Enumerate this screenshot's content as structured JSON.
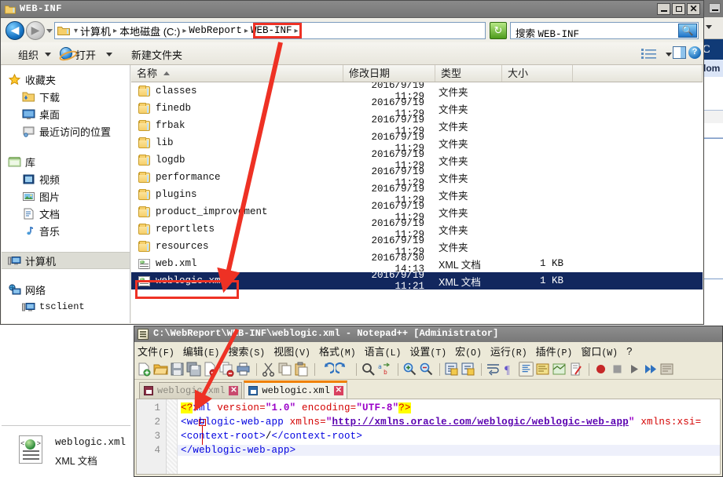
{
  "explorer": {
    "window_title": "WEB-INF",
    "window_buttons": {
      "minimize": "_",
      "maximize": "□",
      "close": "✕"
    },
    "breadcrumb": {
      "items": [
        "计算机",
        "本地磁盘 (C:)",
        "WebReport",
        "WEB-INF"
      ],
      "separator": "▸",
      "highlighted": "WEB-INF"
    },
    "refresh_label": "↻",
    "search": {
      "value": "搜索 WEB-INF",
      "prefix": "搜索 ",
      "term": "WEB-INF",
      "icon": "🔍"
    },
    "toolbar": {
      "organize": "组织",
      "open": "打开",
      "new_folder": "新建文件夹",
      "help": "?"
    },
    "nav_pane": {
      "groups": [
        {
          "header": {
            "label": "收藏夹",
            "icon": "star-icon"
          },
          "items": [
            {
              "label": "下载",
              "icon": "download-folder-icon"
            },
            {
              "label": "桌面",
              "icon": "desktop-icon"
            },
            {
              "label": "最近访问的位置",
              "icon": "recent-places-icon"
            }
          ]
        },
        {
          "header": {
            "label": "库",
            "icon": "library-icon"
          },
          "items": [
            {
              "label": "视频",
              "icon": "video-icon"
            },
            {
              "label": "图片",
              "icon": "picture-icon"
            },
            {
              "label": "文档",
              "icon": "document-icon"
            },
            {
              "label": "音乐",
              "icon": "music-icon"
            }
          ]
        },
        {
          "header": {
            "label": "计算机",
            "icon": "computer-icon",
            "selected": true
          },
          "items": []
        },
        {
          "header": {
            "label": "网络",
            "icon": "network-icon"
          },
          "items": [
            {
              "label": "tsclient",
              "icon": "computer-icon"
            }
          ]
        }
      ]
    },
    "columns": [
      {
        "key": "name",
        "label": "名称",
        "sorted": true
      },
      {
        "key": "date",
        "label": "修改日期"
      },
      {
        "key": "type",
        "label": "类型"
      },
      {
        "key": "size",
        "label": "大小"
      }
    ],
    "rows": [
      {
        "name": "classes",
        "date": "2016/9/19 11:29",
        "type": "文件夹",
        "size": "",
        "icon": "folder-icon"
      },
      {
        "name": "finedb",
        "date": "2016/9/19 11:29",
        "type": "文件夹",
        "size": "",
        "icon": "folder-icon"
      },
      {
        "name": "frbak",
        "date": "2016/9/19 11:29",
        "type": "文件夹",
        "size": "",
        "icon": "folder-icon"
      },
      {
        "name": "lib",
        "date": "2016/9/19 11:29",
        "type": "文件夹",
        "size": "",
        "icon": "folder-icon"
      },
      {
        "name": "logdb",
        "date": "2016/9/19 11:29",
        "type": "文件夹",
        "size": "",
        "icon": "folder-icon"
      },
      {
        "name": "performance",
        "date": "2016/9/19 11:29",
        "type": "文件夹",
        "size": "",
        "icon": "folder-icon"
      },
      {
        "name": "plugins",
        "date": "2016/9/19 11:29",
        "type": "文件夹",
        "size": "",
        "icon": "folder-icon"
      },
      {
        "name": "product_improvement",
        "date": "2016/9/19 11:29",
        "type": "文件夹",
        "size": "",
        "icon": "folder-icon"
      },
      {
        "name": "reportlets",
        "date": "2016/9/19 11:29",
        "type": "文件夹",
        "size": "",
        "icon": "folder-icon"
      },
      {
        "name": "resources",
        "date": "2016/9/19 11:29",
        "type": "文件夹",
        "size": "",
        "icon": "folder-icon"
      },
      {
        "name": "web.xml",
        "date": "2016/8/30 14:13",
        "type": "XML 文档",
        "size": "1 KB",
        "icon": "xml-file-icon"
      },
      {
        "name": "weblogic.xml",
        "date": "2016/9/19 11:21",
        "type": "XML 文档",
        "size": "1 KB",
        "icon": "xml-file-icon",
        "selected": true
      }
    ],
    "details": {
      "name": "weblogic.xml",
      "type": "XML 文档"
    }
  },
  "notepad": {
    "title": "C:\\WebReport\\WEB-INF\\weblogic.xml - Notepad++ [Administrator]",
    "menu": [
      "文件(F)",
      "编辑(E)",
      "搜索(S)",
      "视图(V)",
      "格式(M)",
      "语言(L)",
      "设置(T)",
      "宏(O)",
      "运行(R)",
      "插件(P)",
      "窗口(W)",
      "?"
    ],
    "tabs": [
      {
        "label": "weblogic.xml",
        "active": false,
        "close": "✕"
      },
      {
        "label": "weblogic.xml",
        "active": true,
        "close": "✕"
      }
    ],
    "line_numbers": [
      "1",
      "2",
      "3",
      "4"
    ],
    "code": {
      "line1": {
        "open": "<?",
        "tag": "xml",
        "attr1": " version=",
        "val1": "\"1.0\"",
        "attr2": " encoding=",
        "val2": "\"UTF-8\"",
        "close": "?>"
      },
      "line2": {
        "tag_open": "<weblogic-web-app",
        "attr": " xmlns=",
        "quote": "\"",
        "url": "http://xmlns.oracle.com/weblogic/weblogic-web-app",
        "quote_end": "\"",
        "attr2": " xmlns:xsi="
      },
      "line3": {
        "open_tag": "<context-root>",
        "value": "/",
        "close_tag": "</context-root>"
      },
      "line4": {
        "close_tag": "</weblogic-web-app>"
      }
    }
  },
  "background_window": {
    "header_char": "C",
    "row_text": "dom"
  },
  "annotations": {
    "highlight_boxes": [
      {
        "name": "breadcrumb-web-inf-box"
      },
      {
        "name": "weblogic-xml-row-box"
      }
    ],
    "arrow_color": "#ee3124"
  }
}
